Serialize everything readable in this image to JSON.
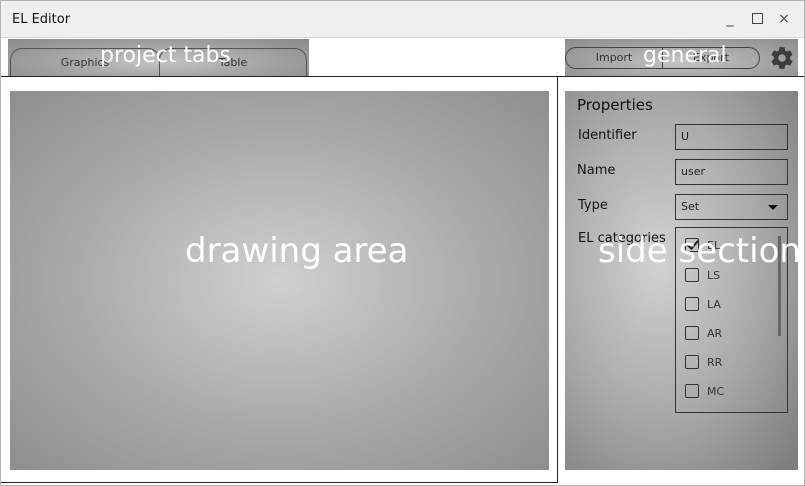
{
  "window": {
    "title": "EL Editor",
    "controls": {
      "minimize": "_",
      "maximize": "",
      "close": "×"
    }
  },
  "project_tabs": {
    "overlay_label": "project tabs",
    "tabs": [
      {
        "label": "Graphics",
        "selected": true
      },
      {
        "label": "Table",
        "selected": false
      }
    ]
  },
  "general": {
    "overlay_label": "general",
    "import_label": "Import",
    "export_label": "Export",
    "settings_icon": "gear-icon"
  },
  "drawing_area": {
    "overlay_label": "drawing area"
  },
  "side_section": {
    "overlay_label": "side section",
    "title": "Properties",
    "identifier": {
      "label": "Identifier",
      "value": "U"
    },
    "name": {
      "label": "Name",
      "value": "user"
    },
    "type": {
      "label": "Type",
      "value": "Set"
    },
    "categories": {
      "label": "EL categories",
      "items": [
        {
          "label": "EL",
          "checked": true
        },
        {
          "label": "LS",
          "checked": false
        },
        {
          "label": "LA",
          "checked": false
        },
        {
          "label": "AR",
          "checked": false
        },
        {
          "label": "RR",
          "checked": false
        },
        {
          "label": "MC",
          "checked": false
        }
      ]
    }
  }
}
